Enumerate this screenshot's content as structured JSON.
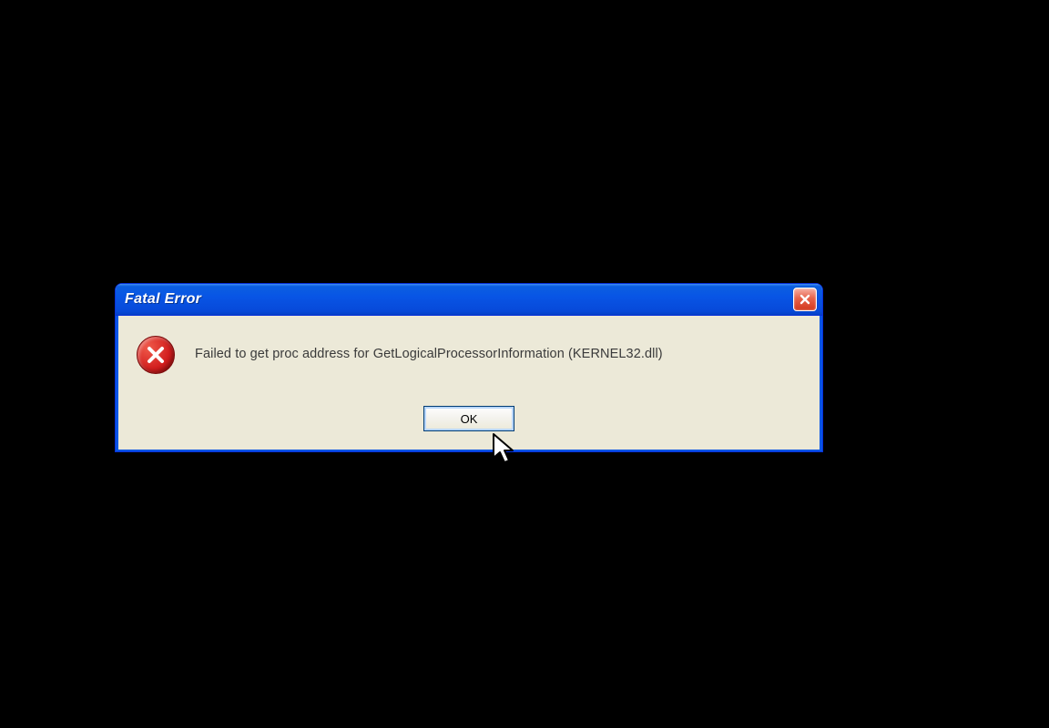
{
  "dialog": {
    "title": "Fatal Error",
    "message": "Failed to get proc address for GetLogicalProcessorInformation (KERNEL32.dll)",
    "ok_label": "OK"
  }
}
